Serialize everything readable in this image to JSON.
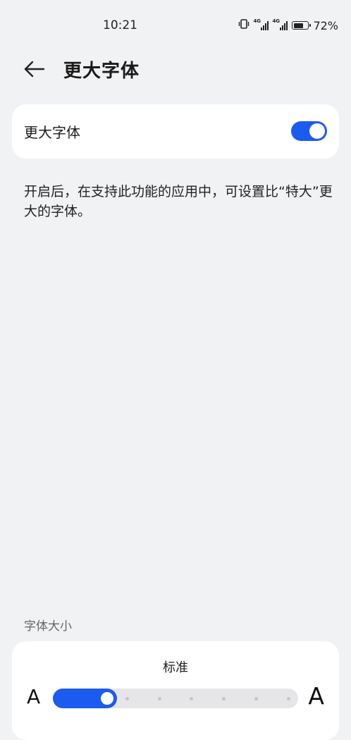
{
  "status_bar": {
    "time": "10:21",
    "net1": "4G",
    "net2": "4G",
    "battery_text": "72%",
    "battery_level": 0.72,
    "icons": [
      "vibrate-icon",
      "signal-icon",
      "signal-icon",
      "battery-icon"
    ]
  },
  "header": {
    "title": "更大字体",
    "back_icon": "back-arrow-icon"
  },
  "toggle": {
    "label": "更大字体",
    "on": true
  },
  "description": "开启后，在支持此功能的应用中，可设置比“特大”更大的字体。",
  "font_size": {
    "section_label": "字体大小",
    "value_label": "标准",
    "small_glyph": "A",
    "large_glyph": "A",
    "steps": 8,
    "current_step": 1
  },
  "colors": {
    "accent": "#1b5bf0",
    "background": "#f1f2f4",
    "card": "#ffffff"
  }
}
